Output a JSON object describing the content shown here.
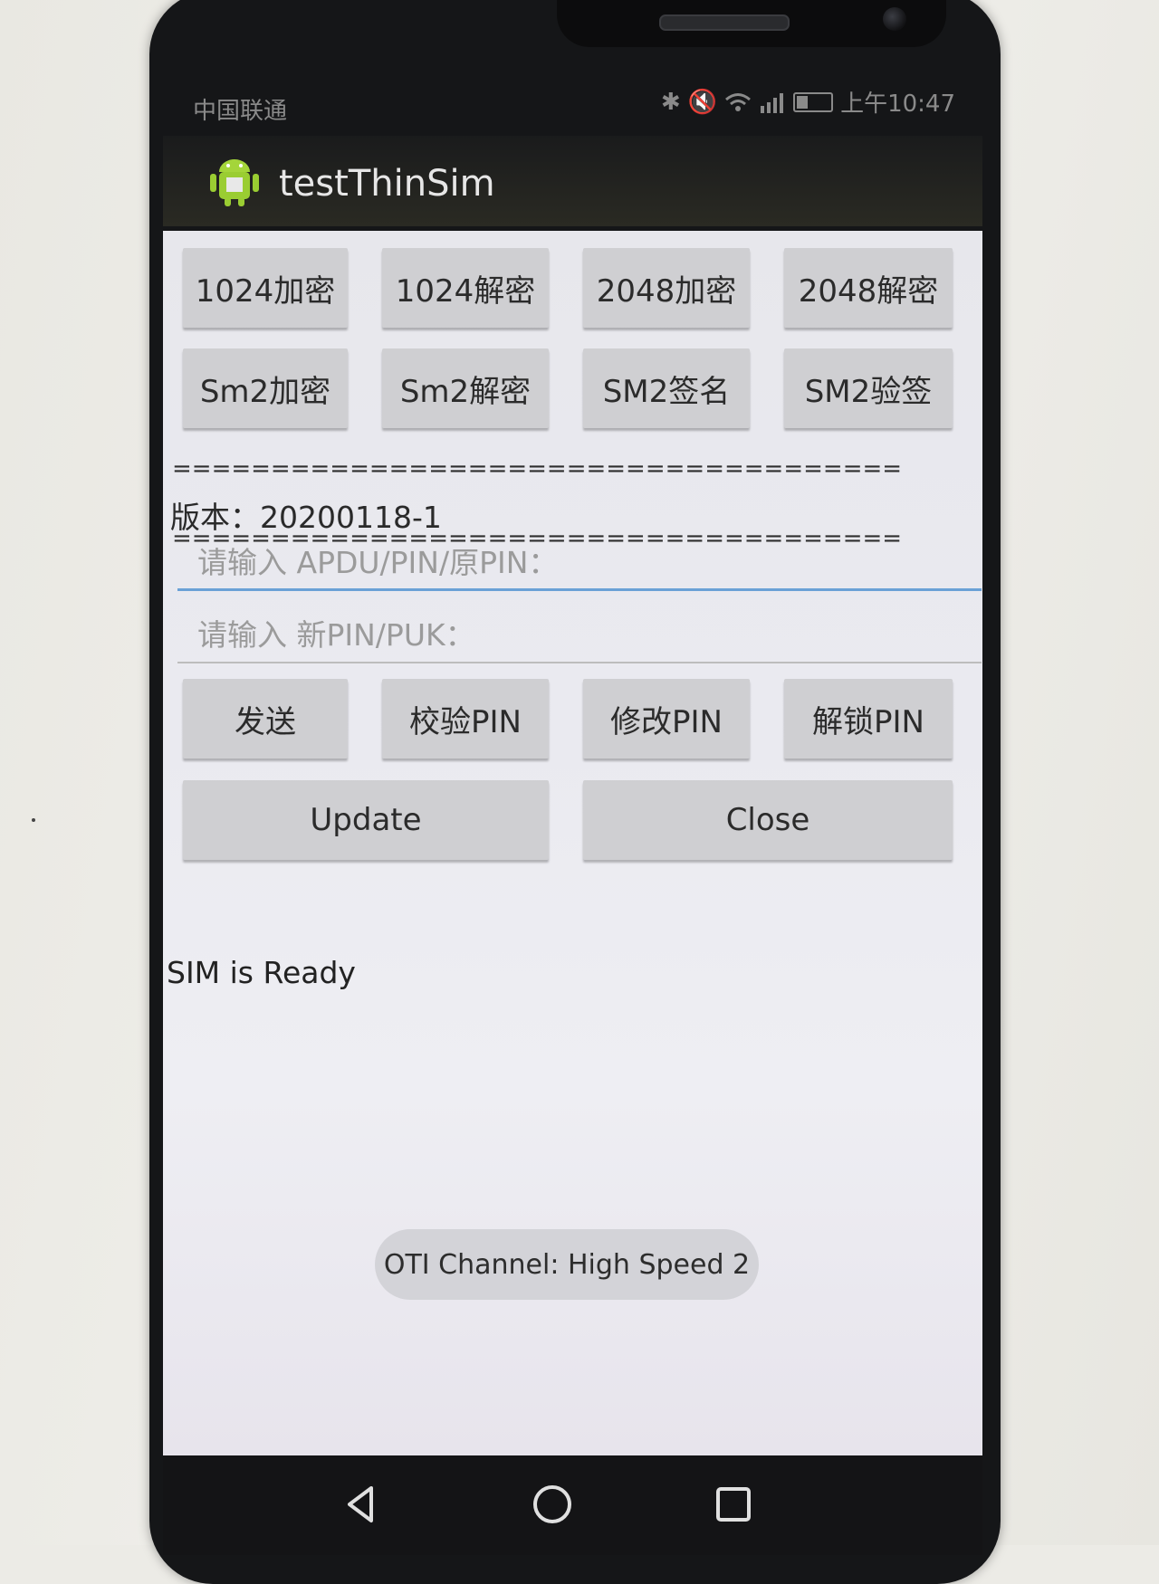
{
  "status_bar": {
    "carrier": "中国联通",
    "time": "上午10:47"
  },
  "app": {
    "title": "testThinSim"
  },
  "buttons_row1": [
    {
      "label": "1024加密"
    },
    {
      "label": "1024解密"
    },
    {
      "label": "2048加密"
    },
    {
      "label": "2048解密"
    }
  ],
  "buttons_row2": [
    {
      "label": "Sm2加密"
    },
    {
      "label": "Sm2解密"
    },
    {
      "label": "SM2签名"
    },
    {
      "label": "SM2验签"
    }
  ],
  "separator": "=====================================",
  "version": "版本：20200118-1",
  "inputs": {
    "apdu_placeholder": "请输入 APDU/PIN/原PIN：",
    "new_pin_placeholder": "请输入  新PIN/PUK："
  },
  "buttons_row3": [
    {
      "label": "发送"
    },
    {
      "label": "校验PIN"
    },
    {
      "label": "修改PIN"
    },
    {
      "label": "解锁PIN"
    }
  ],
  "buttons_row4": [
    {
      "label": "Update"
    },
    {
      "label": "Close"
    }
  ],
  "status_message": "SIM is Ready",
  "toast": "OTI Channel: High Speed 2",
  "icons": [
    "android-icon",
    "bluetooth-icon",
    "mute-icon",
    "wifi-icon",
    "signal-icon",
    "battery-icon",
    "back-icon",
    "home-icon",
    "recents-icon"
  ]
}
